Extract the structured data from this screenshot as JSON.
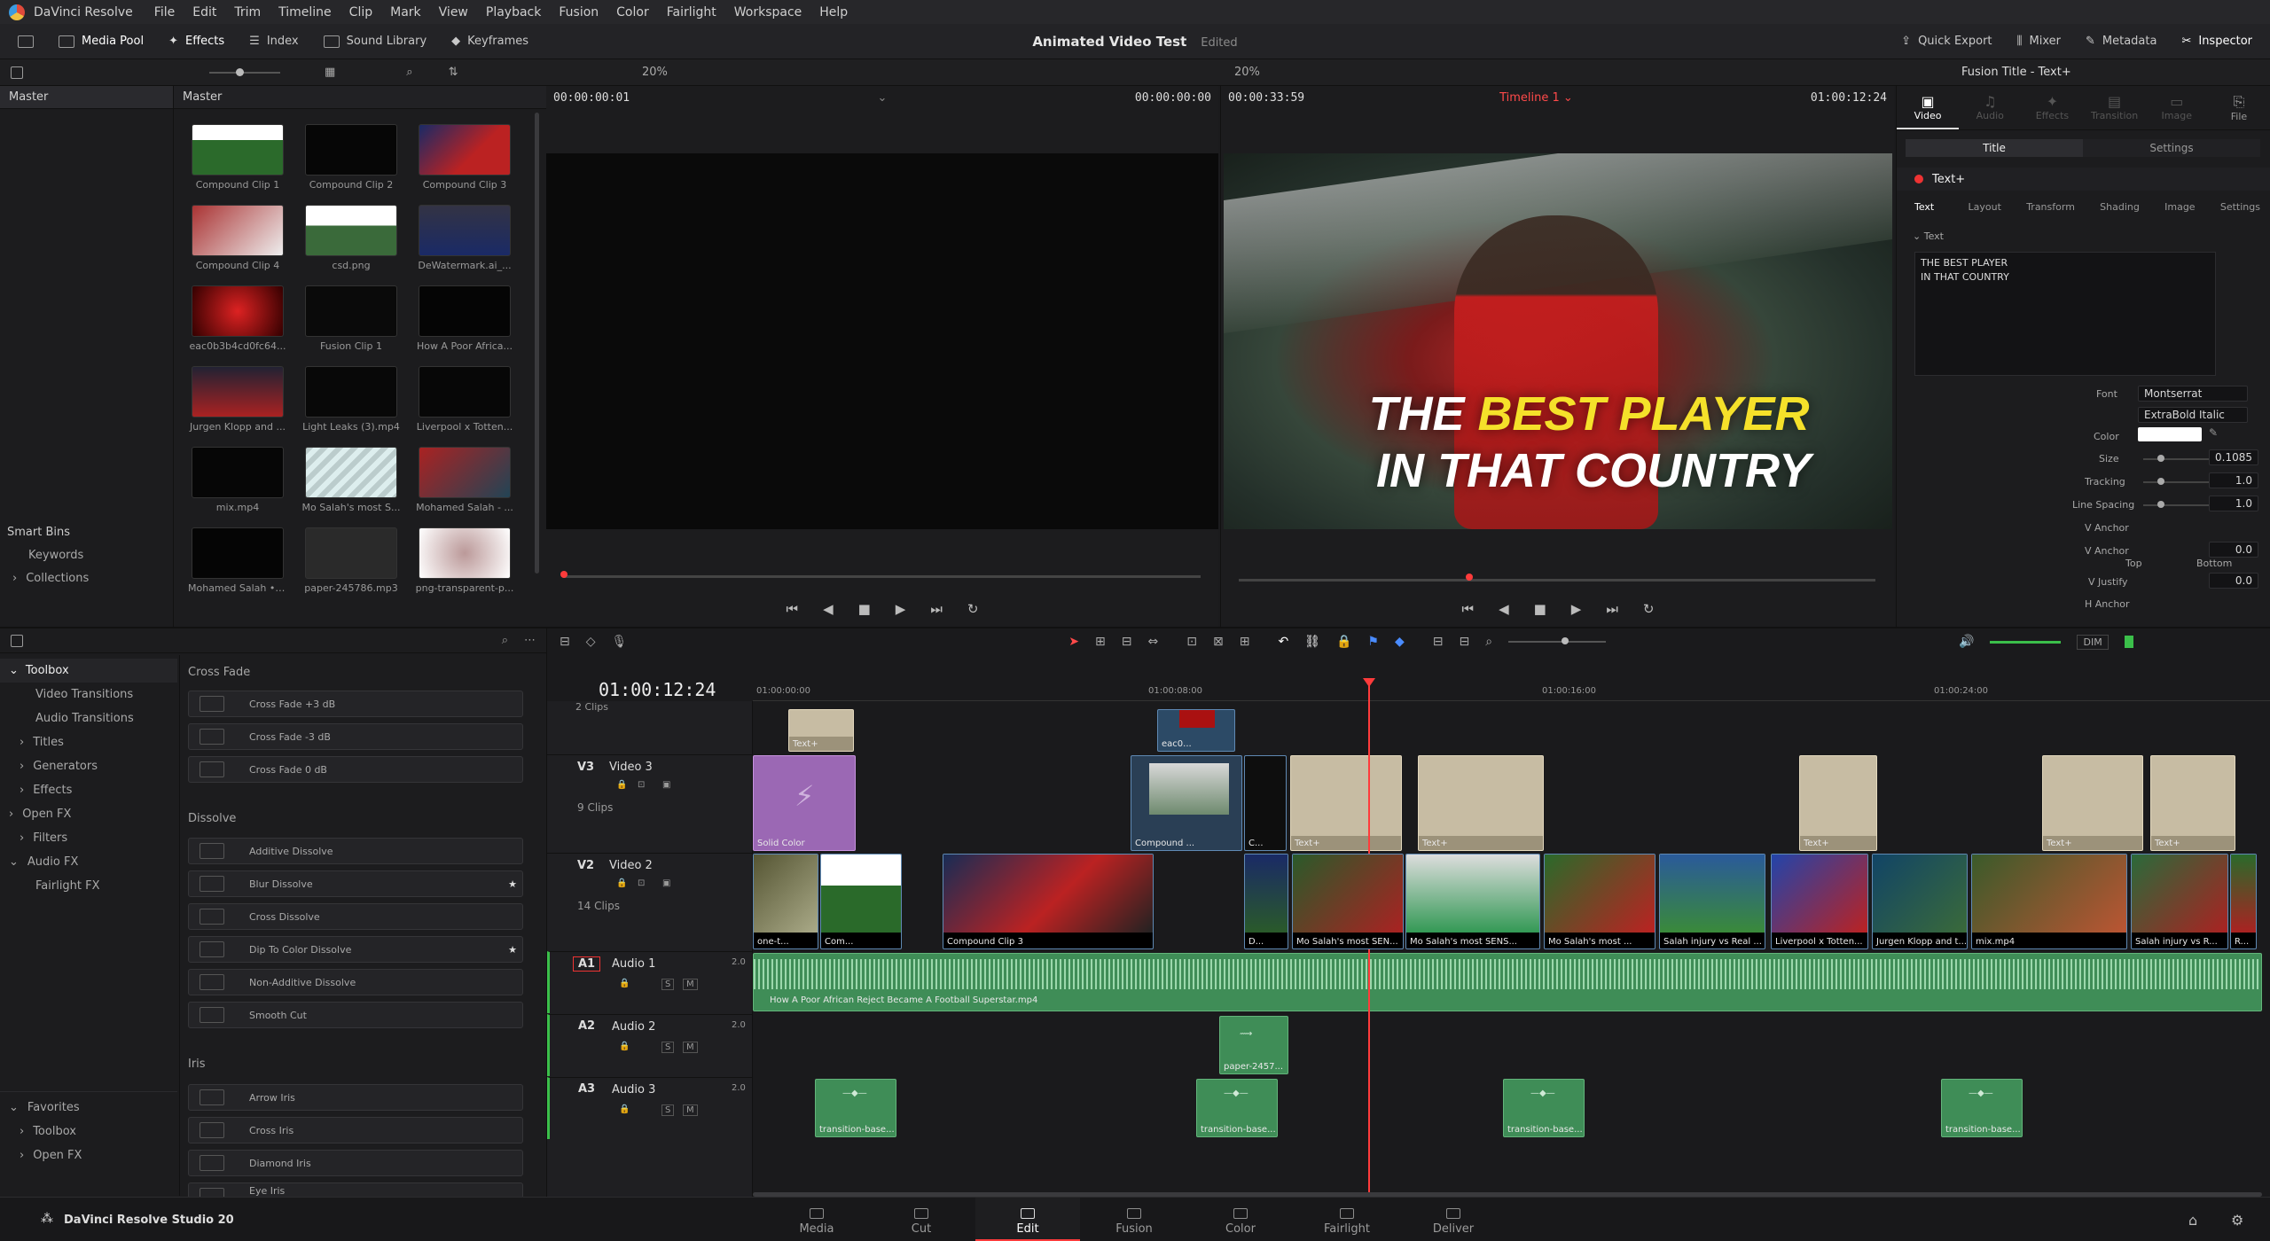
{
  "menubar": {
    "app": "DaVinci Resolve",
    "items": [
      "File",
      "Edit",
      "Trim",
      "Timeline",
      "Clip",
      "Mark",
      "View",
      "Playback",
      "Fusion",
      "Color",
      "Fairlight",
      "Workspace",
      "Help"
    ]
  },
  "toolbar": {
    "media_pool": "Media Pool",
    "effects": "Effects",
    "index": "Index",
    "sound_library": "Sound Library",
    "keyframes": "Keyframes",
    "project": "Animated Video Test",
    "status": "Edited",
    "quick_export": "Quick Export",
    "mixer": "Mixer",
    "metadata": "Metadata",
    "inspector": "Inspector"
  },
  "subbar": {
    "zoom_left": "20%",
    "zoom_right": "20%",
    "inspector_title": "Fusion Title - Text+"
  },
  "media": {
    "bin": "Master",
    "bin_header": "Master",
    "clips": [
      "Compound Clip 1",
      "Compound Clip 2",
      "Compound Clip 3",
      "Compound Clip 4",
      "csd.png",
      "DeWatermark.ai_...",
      "eac0b3b4cd0fc64...",
      "Fusion Clip 1",
      "How A Poor Africa...",
      "Jurgen Klopp and ...",
      "Light Leaks (3).mp4",
      "Liverpool x Totten...",
      "mix.mp4",
      "Mo Salah's most S...",
      "Mohamed Salah - ...",
      "Mohamed Salah • ...",
      "paper-245786.mp3",
      "png-transparent-p..."
    ],
    "smart_bins": "Smart Bins",
    "keywords": "Keywords",
    "collections": "Collections"
  },
  "source_viewer": {
    "tc_left": "00:00:00:01",
    "tc_right": "00:00:00:00"
  },
  "timeline_viewer": {
    "tc_left": "00:00:33:59",
    "timeline_name": "Timeline 1",
    "tc_right": "01:00:12:24",
    "line1_a": "THE ",
    "line1_b": "BEST PLAYER",
    "line2": "IN THAT COUNTRY"
  },
  "inspector": {
    "tabs": [
      "Video",
      "Audio",
      "Effects",
      "Transition",
      "Image",
      "File"
    ],
    "subtabs": [
      "Title",
      "Settings"
    ],
    "node": "Text+",
    "node_tabs": [
      "Text",
      "Layout",
      "Transform",
      "Shading",
      "Image",
      "Settings"
    ],
    "section": "Text",
    "text_value_1": "THE BEST PLAYER",
    "text_value_2": "IN THAT COUNTRY",
    "font_label": "Font",
    "font": "Montserrat",
    "style": "ExtraBold Italic",
    "color_label": "Color",
    "size_label": "Size",
    "size": "0.1085",
    "tracking_label": "Tracking",
    "tracking": "1.0",
    "linespacing_label": "Line Spacing",
    "linespacing": "1.0",
    "vanchor_label": "V Anchor",
    "vanchor2_label": "V Anchor",
    "vanchor_val": "0.0",
    "top": "Top",
    "bottom": "Bottom",
    "vjustify_label": "V Justify",
    "vjustify": "0.0",
    "hanchor_label": "H Anchor"
  },
  "effects": {
    "toolbox": "Toolbox",
    "video_transitions": "Video Transitions",
    "audio_transitions": "Audio Transitions",
    "titles": "Titles",
    "generators": "Generators",
    "effects": "Effects",
    "open_fx": "Open FX",
    "filters": "Filters",
    "audio_fx": "Audio FX",
    "fairlight_fx": "Fairlight FX",
    "favorites": "Favorites",
    "fav_toolbox": "Toolbox",
    "fav_openfx": "Open FX",
    "cross_fade": "Cross Fade",
    "cf1": "Cross Fade +3 dB",
    "cf2": "Cross Fade -3 dB",
    "cf3": "Cross Fade 0 dB",
    "dissolve": "Dissolve",
    "d1": "Additive Dissolve",
    "d2": "Blur Dissolve",
    "d3": "Cross Dissolve",
    "d4": "Dip To Color Dissolve",
    "d5": "Non-Additive Dissolve",
    "d6": "Smooth Cut",
    "iris": "Iris",
    "i1": "Arrow Iris",
    "i2": "Cross Iris",
    "i3": "Diamond Iris",
    "i4": "Eye Iris"
  },
  "timeline": {
    "timecode": "01:00:12:24",
    "ruler": [
      "01:00:00:00",
      "01:00:08:00",
      "01:00:16:00",
      "01:00:24:00"
    ],
    "dim": "DIM",
    "v4_count": "2 Clips",
    "v3": {
      "id": "V3",
      "name": "Video 3",
      "count": "9 Clips"
    },
    "v2": {
      "id": "V2",
      "name": "Video 2",
      "count": "14 Clips"
    },
    "a1": {
      "id": "A1",
      "name": "Audio 1",
      "ch": "2.0",
      "clip": "How A Poor African Reject Became A Football Superstar.mp4"
    },
    "a2": {
      "id": "A2",
      "name": "Audio 2",
      "ch": "2.0",
      "clip": "paper-2457..."
    },
    "a3": {
      "id": "A3",
      "name": "Audio 3",
      "ch": "2.0",
      "clip": "transition-base..."
    },
    "v4_clips": [
      "Text+",
      "eac0..."
    ],
    "v3_clips": [
      "Solid Color",
      "Compound ...",
      "C...",
      "Text+",
      "Text+",
      "Text+",
      "Text+",
      "Text+"
    ],
    "v2_clips": [
      "one-t...",
      "Com...",
      "Compound Clip 3",
      "D...",
      "Mo Salah's most SEN...",
      "Mo Salah's most SENS...",
      "Mo Salah's most ...",
      "Salah injury vs Real ...",
      "Liverpool x Totten...",
      "Jurgen Klopp and t...",
      "mix.mp4",
      "Salah injury vs R...",
      "R..."
    ]
  },
  "footer": {
    "brand": "DaVinci Resolve Studio 20",
    "pages": [
      "Media",
      "Cut",
      "Edit",
      "Fusion",
      "Color",
      "Fairlight",
      "Deliver"
    ]
  },
  "colors": {
    "accent": "#ff3b3b",
    "title_yellow": "#f5e12a"
  }
}
